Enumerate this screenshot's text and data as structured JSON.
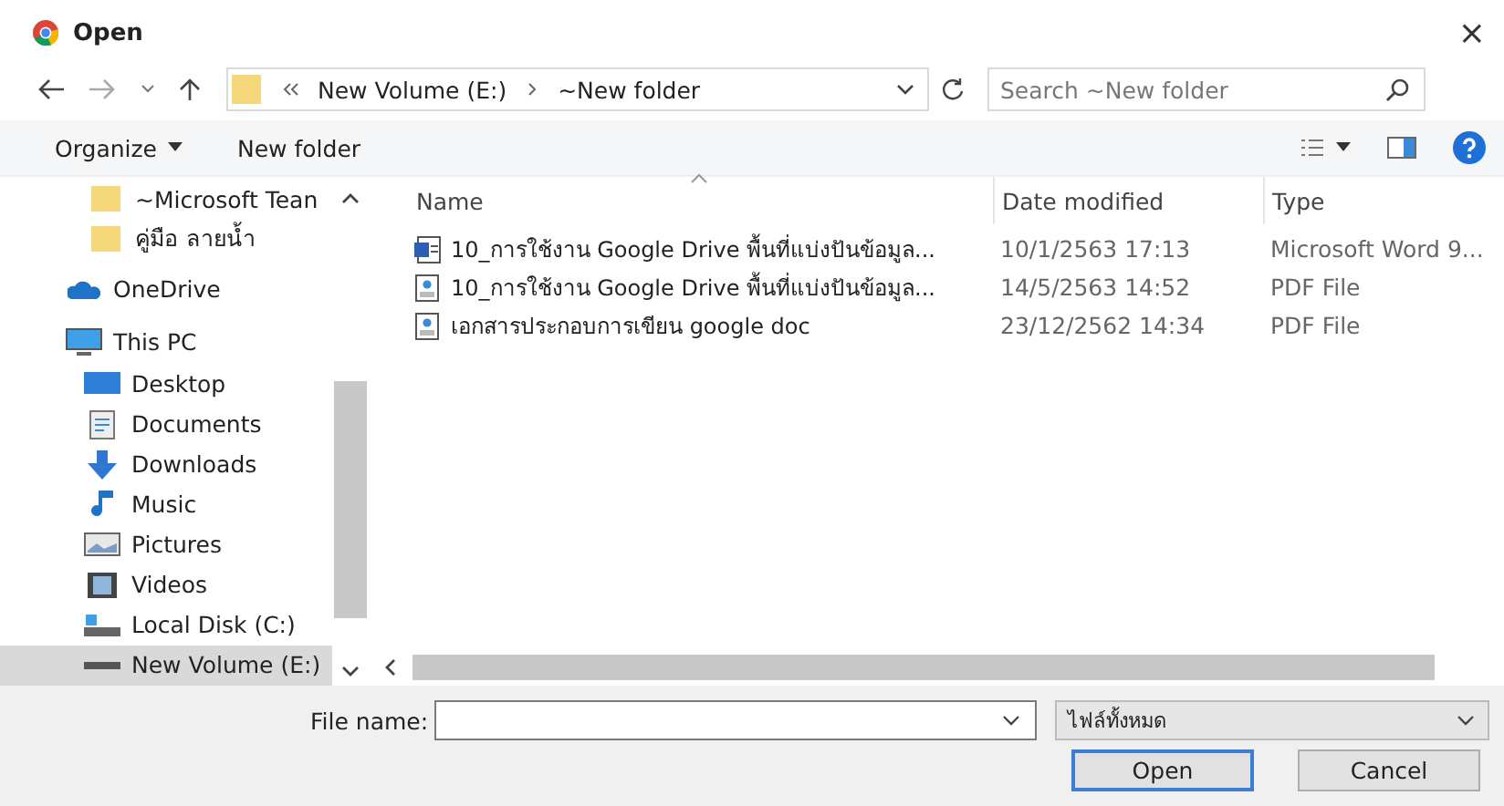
{
  "window": {
    "title": "Open",
    "close": "×"
  },
  "address": {
    "path": [
      "New Volume (E:)",
      "~New folder"
    ],
    "search_placeholder": "Search ~New folder"
  },
  "toolbar": {
    "organize": "Organize",
    "new_folder": "New folder"
  },
  "sidebar": {
    "items": [
      {
        "label": "~Microsoft Tean",
        "selected": false,
        "kind": "quick"
      },
      {
        "label": "คู่มือ ลายน้ำ",
        "selected": false,
        "kind": "quick"
      },
      {
        "label": "OneDrive",
        "selected": false,
        "kind": "location"
      },
      {
        "label": "This PC",
        "selected": false,
        "kind": "location",
        "children": [
          {
            "label": "Desktop",
            "selected": false
          },
          {
            "label": "Documents",
            "selected": false
          },
          {
            "label": "Downloads",
            "selected": false
          },
          {
            "label": "Music",
            "selected": false
          },
          {
            "label": "Pictures",
            "selected": false
          },
          {
            "label": "Videos",
            "selected": false
          },
          {
            "label": "Local Disk (C:)",
            "selected": false
          },
          {
            "label": "New Volume (E:)",
            "selected": true
          }
        ]
      }
    ]
  },
  "table": {
    "columns": [
      "Name",
      "Date modified",
      "Type"
    ],
    "rows": [
      {
        "name": "10_การใช้งาน Google Drive พื้นที่แบ่งปันข้อมูล...",
        "date": "10/1/2563 17:13",
        "type": "Microsoft Word 9...",
        "kind": "word"
      },
      {
        "name": "10_การใช้งาน Google Drive พื้นที่แบ่งปันข้อมูล...",
        "date": "14/5/2563 14:52",
        "type": "PDF File",
        "kind": "pdf"
      },
      {
        "name": "เอกสารประกอบการเขียน google doc",
        "date": "23/12/2562 14:34",
        "type": "PDF File",
        "kind": "pdf"
      }
    ]
  },
  "footer": {
    "file_name_label": "File name:",
    "filter": "ไฟล์ทั้งหมด",
    "buttons": [
      "Open",
      "Cancel"
    ]
  }
}
